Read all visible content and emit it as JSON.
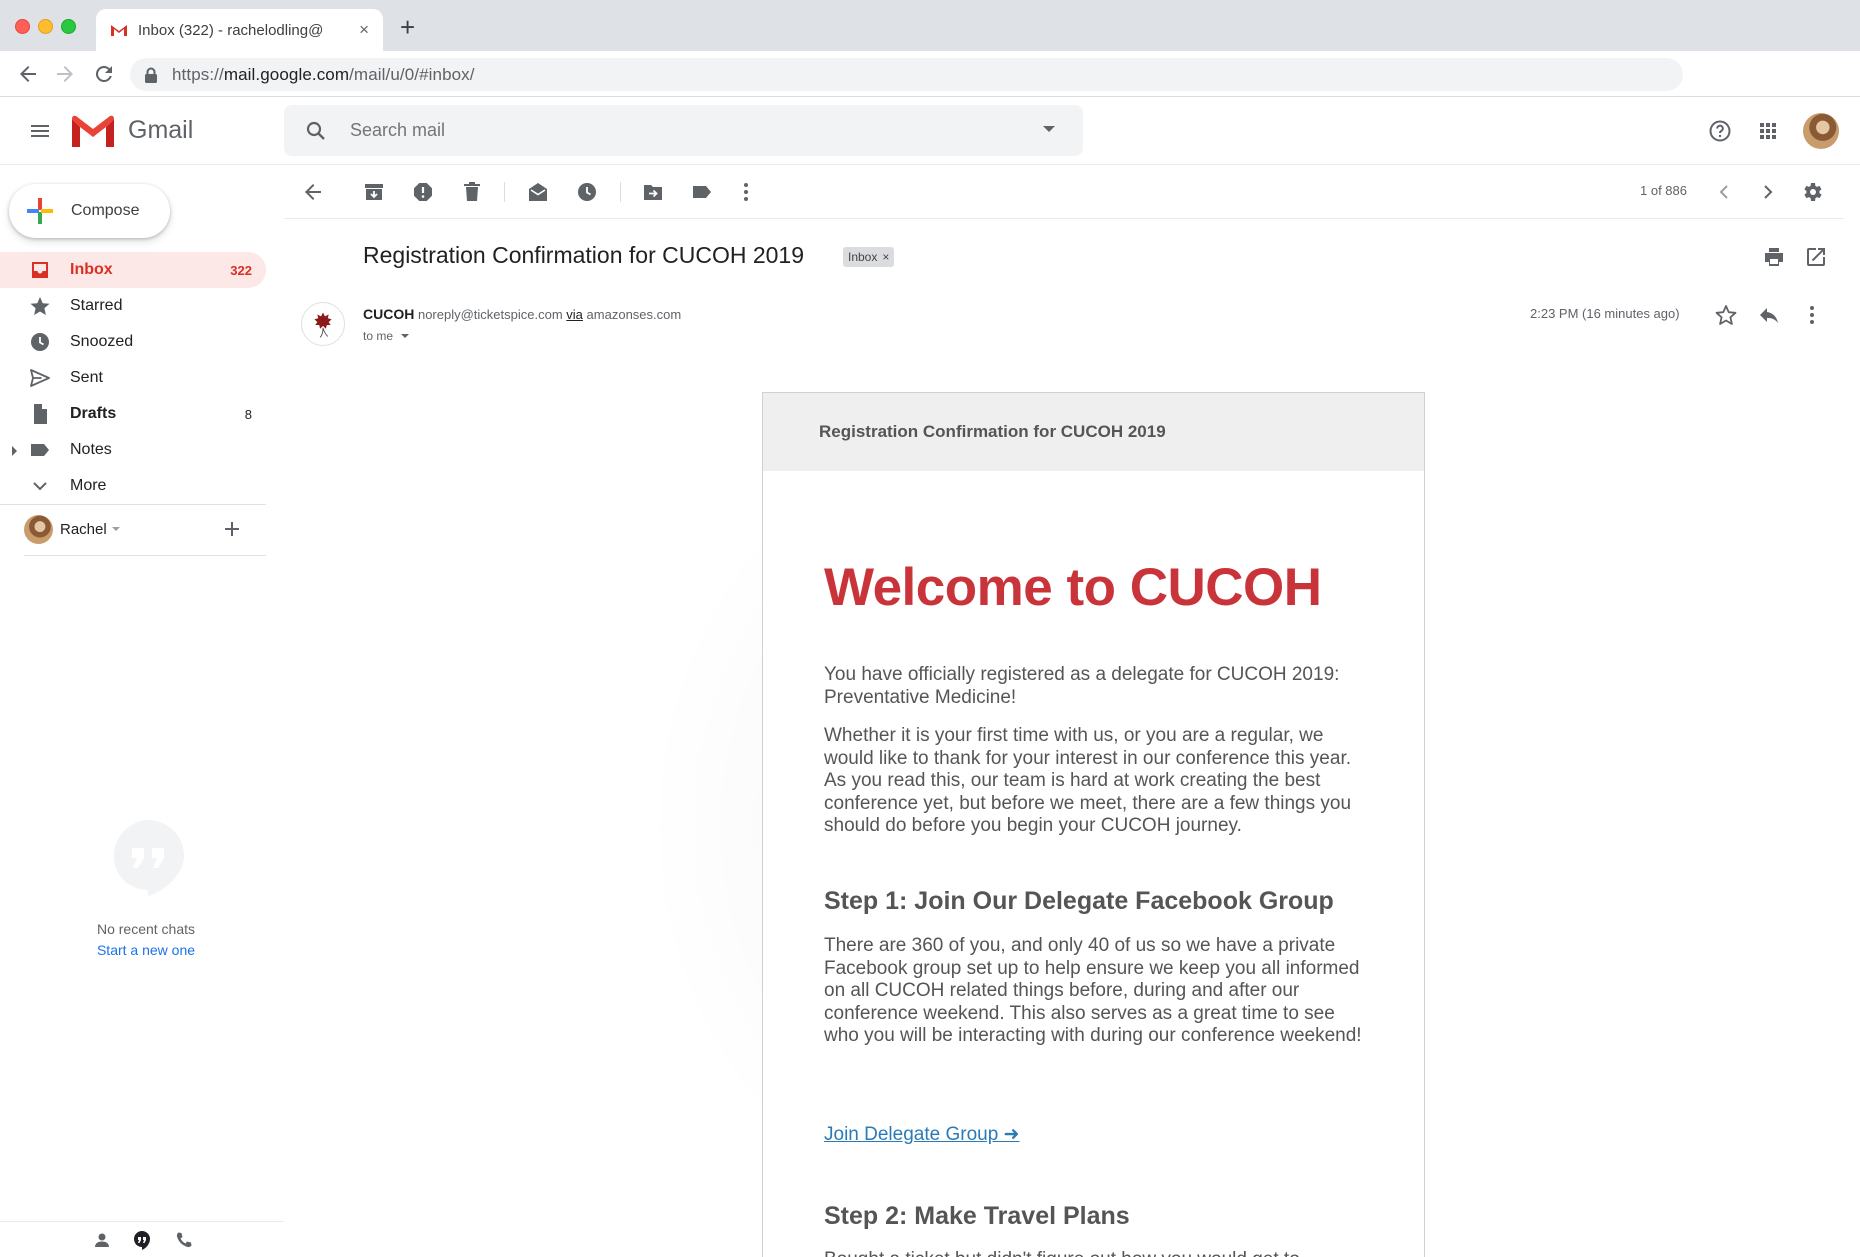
{
  "browser": {
    "tab_title": "Inbox (322) - rachelodling@",
    "tab_close": "×",
    "new_tab": "+",
    "url_scheme": "https://",
    "url_host": "mail.google.com",
    "url_path": "/mail/u/0/#inbox/"
  },
  "header": {
    "app_name": "Gmail",
    "search_placeholder": "Search mail"
  },
  "sidebar": {
    "compose_label": "Compose",
    "items": [
      {
        "label": "Inbox",
        "count": "322"
      },
      {
        "label": "Starred",
        "count": ""
      },
      {
        "label": "Snoozed",
        "count": ""
      },
      {
        "label": "Sent",
        "count": ""
      },
      {
        "label": "Drafts",
        "count": "8"
      },
      {
        "label": "Notes",
        "count": ""
      },
      {
        "label": "More",
        "count": ""
      }
    ],
    "hangouts_user": "Rachel",
    "hangouts_add": "+",
    "no_chats": "No recent chats",
    "start_chat": "Start a new one"
  },
  "toolbar": {
    "pager": "1 of 886"
  },
  "message": {
    "subject": "Registration Confirmation for CUCOH 2019",
    "label": "Inbox",
    "label_remove": "×",
    "sender_name": "CUCOH",
    "sender_email": "noreply@ticketspice.com",
    "via_word": "via",
    "via_domain": "amazonses.com",
    "to": "to me",
    "time": "2:23 PM (16 minutes ago)"
  },
  "email": {
    "header_title": "Registration Confirmation for CUCOH 2019",
    "welcome": "Welcome to CUCOH",
    "intro": "You have officially registered as a delegate for CUCOH 2019: Preventative Medicine!",
    "thanks": "Whether it is your first time with us, or you are a regular, we would like to thank for your interest in our conference this year. As you read this, our team is hard at work creating the best conference yet, but before we meet, there are a few things you should do before you begin your CUCOH journey.",
    "step1_title": "Step 1: Join Our Delegate Facebook Group",
    "step1_text": "There are 360 of you, and only 40 of us so we have a private Facebook group set up to help ensure we keep you all informed on all CUCOH related things before, during and after our conference weekend. This also serves as a great time to see who you will be interacting with during our conference weekend!",
    "step1_link": "Join Delegate Group ➜",
    "step2_title": "Step 2: Make Travel Plans",
    "step2_text": "Bought a ticket but didn't figure out how you would get to"
  },
  "colors": {
    "accent_red": "#d93025",
    "welcome_red": "#c9343a",
    "link_blue": "#2a7ab8",
    "active_nav_bg": "#fce8e6"
  },
  "icons": {
    "sidebar": [
      "inbox-icon",
      "star-icon",
      "clock-icon",
      "send-icon",
      "draft-icon",
      "label-icon",
      "chevron-down-icon"
    ],
    "toolbar": [
      "back-arrow-icon",
      "archive-icon",
      "report-spam-icon",
      "delete-icon",
      "mark-unread-icon",
      "snooze-icon",
      "move-to-icon",
      "label-icon",
      "more-vert-icon",
      "chevron-left-icon",
      "chevron-right-icon",
      "settings-icon"
    ]
  }
}
